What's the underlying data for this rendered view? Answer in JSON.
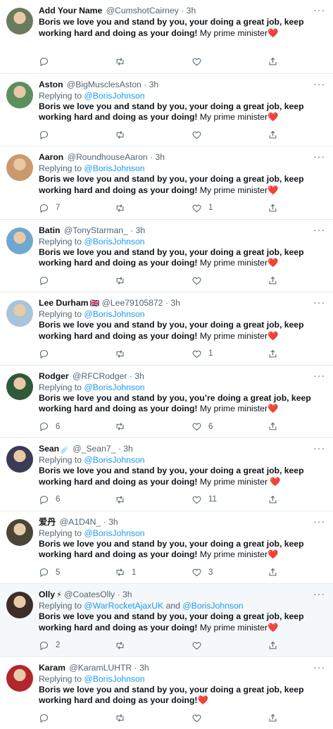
{
  "tweets": [
    {
      "name": "Add Your Name",
      "badge": "",
      "handle": "@CumshotCairney",
      "time": "3h",
      "reply_prefix": "",
      "reply_to": "",
      "reply_and": "",
      "reply_to2": "",
      "bold": "Boris we love you and stand by you, your doing a great job, keep working hard and doing as your doing!",
      "rest": " My prime minister",
      "heart": "❤️",
      "replies": "",
      "retweets": "",
      "likes": "",
      "avatar_color": "#6a7b5c"
    },
    {
      "name": "Aston",
      "badge": "",
      "handle": "@BigMusclesAston",
      "time": "3h",
      "reply_prefix": "Replying to ",
      "reply_to": "@BorisJohnson",
      "reply_and": "",
      "reply_to2": "",
      "bold": "Boris we love you and stand by you, your doing a great job, keep working hard and doing as your doing!",
      "rest": " My prime minister",
      "heart": "❤️",
      "replies": "",
      "retweets": "",
      "likes": "",
      "avatar_color": "#5b8f5e"
    },
    {
      "name": "Aaron",
      "badge": "",
      "handle": "@RoundhouseAaron",
      "time": "3h",
      "reply_prefix": "Replying to ",
      "reply_to": "@BorisJohnson",
      "reply_and": "",
      "reply_to2": "",
      "bold": "Boris we love you and stand by you, your doing a great job, keep working hard and doing as your doing!",
      "rest": " My prime minister",
      "heart": "❤️",
      "replies": "7",
      "retweets": "",
      "likes": "1",
      "avatar_color": "#c99a6e"
    },
    {
      "name": "Batin",
      "badge": "",
      "handle": "@TonyStarman_",
      "time": "3h",
      "reply_prefix": "Replying to ",
      "reply_to": "@BorisJohnson",
      "reply_and": "",
      "reply_to2": "",
      "bold": "Boris we love you and stand by you, your doing a great job, keep working hard and doing as your doing!",
      "rest": " My prime minister",
      "heart": "❤️",
      "replies": "",
      "retweets": "",
      "likes": "",
      "avatar_color": "#6fa7cf"
    },
    {
      "name": "Lee Durham",
      "badge": "🇬🇧",
      "handle": "@Lee79105872",
      "time": "3h",
      "reply_prefix": "Replying to ",
      "reply_to": "@BorisJohnson",
      "reply_and": "",
      "reply_to2": "",
      "bold": "Boris we love you and stand by you, your doing a great job, keep working hard and doing as your doing!",
      "rest": " My prime minister",
      "heart": "❤️",
      "replies": "",
      "retweets": "",
      "likes": "1",
      "avatar_color": "#a8c4d8"
    },
    {
      "name": "Rodger",
      "badge": "",
      "handle": "@RFCRodger",
      "time": "3h",
      "reply_prefix": "Replying to ",
      "reply_to": "@BorisJohnson",
      "reply_and": "",
      "reply_to2": "",
      "bold": "Boris we love you and stand by you, you’re doing a great job, keep working hard and doing as your doing!",
      "rest": " My prime minister",
      "heart": "❤️",
      "replies": "6",
      "retweets": "",
      "likes": "6",
      "avatar_color": "#2f5a3a"
    },
    {
      "name": "Sean",
      "badge": "☄️",
      "handle": "@_Sean7_",
      "time": "3h",
      "reply_prefix": "Replying to ",
      "reply_to": "@BorisJohnson",
      "reply_and": "",
      "reply_to2": "",
      "bold": "Boris we love you and stand by you, your doing a great job, keep working hard and doing as your doing!",
      "rest": " My prime minister ",
      "heart": "❤️",
      "replies": "6",
      "retweets": "",
      "likes": "11",
      "avatar_color": "#3b3b55"
    },
    {
      "name": "爱丹",
      "badge": "",
      "handle": "@A1D4N_",
      "time": "3h",
      "reply_prefix": "Replying to ",
      "reply_to": "@BorisJohnson",
      "reply_and": "",
      "reply_to2": "",
      "bold": "Boris we love you and stand by you, your doing a great job, keep working hard and doing as your doing!",
      "rest": " My prime minister",
      "heart": "❤️",
      "replies": "5",
      "retweets": "1",
      "likes": "3",
      "avatar_color": "#4a4536"
    },
    {
      "name": "Olly",
      "badge": "⚡",
      "handle": "@CoatesOlly",
      "time": "3h",
      "reply_prefix": "Replying to ",
      "reply_to": "@WarRocketAjaxUK",
      "reply_and": " and ",
      "reply_to2": "@BorisJohnson",
      "bold": "Boris we love you and stand by you, your doing a great job, keep working hard and doing as your doing!",
      "rest": " My prime minister",
      "heart": "❤️",
      "replies": "2",
      "retweets": "",
      "likes": "",
      "avatar_color": "#3d2c28",
      "highlight": true
    },
    {
      "name": "Karam",
      "badge": "",
      "handle": "@KaramLUHTR",
      "time": "3h",
      "reply_prefix": "Replying to ",
      "reply_to": "@BorisJohnson",
      "reply_and": "",
      "reply_to2": "",
      "bold": "Boris we love you and stand by you, your doing a great job, keep working hard and doing as your doing!",
      "rest": "",
      "heart": "❤️",
      "replies": "",
      "retweets": "",
      "likes": "",
      "avatar_color": "#b3262b"
    }
  ]
}
